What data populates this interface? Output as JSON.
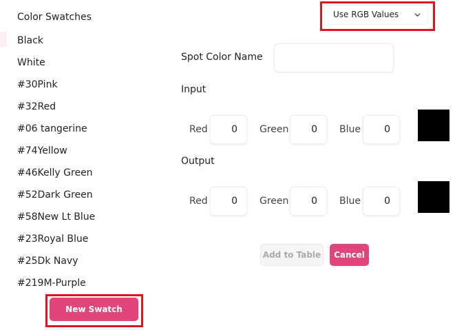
{
  "sidebar": {
    "title": "Color Swatches",
    "items": [
      "Black",
      "White",
      "#30Pink",
      "#32Red",
      "#06 tangerine",
      "#74Yellow",
      "#46Kelly Green",
      "#52Dark Green",
      "#58New Lt Blue",
      "#23Royal Blue",
      "#25Dk Navy",
      "#219M-Purple"
    ],
    "new_swatch_label": "New Swatch"
  },
  "mode_select": {
    "value": "Use RGB Values",
    "icon": "chevron-down-icon"
  },
  "form": {
    "spot_color_label": "Spot Color Name",
    "spot_color_value": "",
    "input_label": "Input",
    "output_label": "Output",
    "red_label": "Red",
    "green_label": "Green",
    "blue_label": "Blue",
    "input_values": {
      "red": "0",
      "green": "0",
      "blue": "0"
    },
    "output_values": {
      "red": "0",
      "green": "0",
      "blue": "0"
    }
  },
  "colors": {
    "accent": "#e0457b",
    "highlight_outline": "#e0151b",
    "input_preview": "#000000",
    "output_preview": "#000000"
  },
  "actions": {
    "add_label": "Add to Table",
    "cancel_label": "Cancel"
  }
}
